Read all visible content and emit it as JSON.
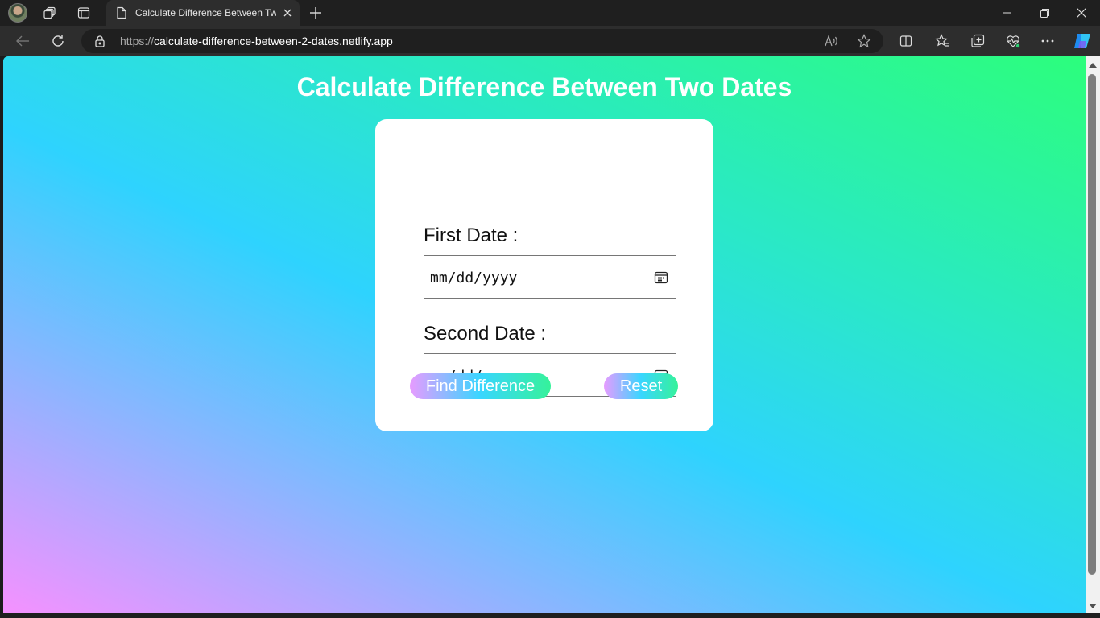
{
  "browser": {
    "tab_title": "Calculate Difference Between Two Dates",
    "url_scheme": "https://",
    "url_host": "calculate-difference-between-2-dates.netlify.app"
  },
  "page": {
    "title": "Calculate Difference Between Two Dates",
    "first_date_label": "First Date :",
    "first_date_value": "mm/dd/yyyy",
    "second_date_label": "Second Date :",
    "second_date_value": "mm/dd/yyyy",
    "find_button": "Find Difference",
    "reset_button": "Reset"
  },
  "colors": {
    "gradient": [
      "#f591ff",
      "#8cb5ff",
      "#2ed3fe",
      "#2ae8c8",
      "#2cfe7c"
    ],
    "button_gradient": [
      "#e79bff",
      "#39d6ff",
      "#35f29a"
    ]
  }
}
